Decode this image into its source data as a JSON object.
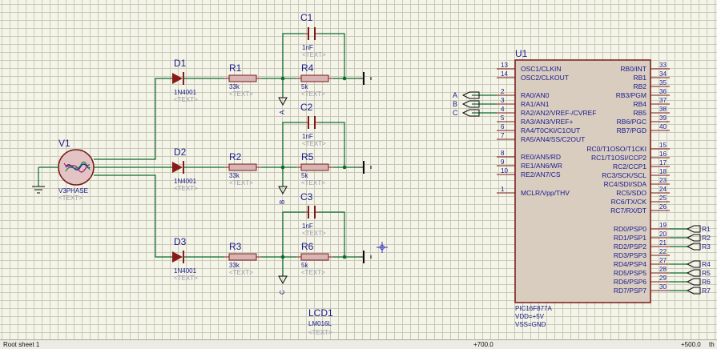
{
  "v1": {
    "ref": "V1",
    "value": "V3PHASE",
    "text": "<TEXT>"
  },
  "diodes": [
    {
      "ref": "D1",
      "value": "1N4001",
      "text": "<TEXT>"
    },
    {
      "ref": "D2",
      "value": "1N4001",
      "text": "<TEXT>"
    },
    {
      "ref": "D3",
      "value": "1N4001",
      "text": "<TEXT>"
    }
  ],
  "resistors_in": [
    {
      "ref": "R1",
      "value": "33k",
      "text": "<TEXT>"
    },
    {
      "ref": "R2",
      "value": "33k",
      "text": "<TEXT>"
    },
    {
      "ref": "R3",
      "value": "33k",
      "text": "<TEXT>"
    }
  ],
  "resistors_fb": [
    {
      "ref": "R4",
      "value": "5k",
      "text": "<TEXT>"
    },
    {
      "ref": "R5",
      "value": "5k",
      "text": "<TEXT>"
    },
    {
      "ref": "R6",
      "value": "5k",
      "text": "<TEXT>"
    }
  ],
  "capacitors": [
    {
      "ref": "C1",
      "value": "1nF",
      "text": "<TEXT>"
    },
    {
      "ref": "C2",
      "value": "1nF",
      "text": "<TEXT>"
    },
    {
      "ref": "C3",
      "value": "1nF",
      "text": "<TEXT>"
    }
  ],
  "node_labels": [
    "A",
    "B",
    "C"
  ],
  "mcu": {
    "ref": "U1",
    "part": "PIC16F877A",
    "vdd": "VDD=+5V",
    "vss": "VSS=GND",
    "left_pins": [
      {
        "num": "13",
        "name": "OSC1/CLKIN"
      },
      {
        "num": "14",
        "name": "OSC2/CLKOUT"
      },
      {
        "num": "2",
        "name": "RA0/AN0"
      },
      {
        "num": "3",
        "name": "RA1/AN1"
      },
      {
        "num": "4",
        "name": "RA2/AN2/VREF-/CVREF"
      },
      {
        "num": "5",
        "name": "RA3/AN3/VREF+"
      },
      {
        "num": "6",
        "name": "RA4/T0CKI/C1OUT"
      },
      {
        "num": "7",
        "name": "RA5/AN4/SS/C2OUT"
      },
      {
        "num": "8",
        "name": "RE0/AN5/RD"
      },
      {
        "num": "9",
        "name": "RE1/AN6/WR"
      },
      {
        "num": "10",
        "name": "RE2/AN7/CS"
      },
      {
        "num": "1",
        "name": "MCLR/Vpp/THV"
      }
    ],
    "right_pins": [
      {
        "num": "33",
        "name": "RB0/INT"
      },
      {
        "num": "34",
        "name": "RB1"
      },
      {
        "num": "35",
        "name": "RB2"
      },
      {
        "num": "36",
        "name": "RB3/PGM"
      },
      {
        "num": "37",
        "name": "RB4"
      },
      {
        "num": "38",
        "name": "RB5"
      },
      {
        "num": "39",
        "name": "RB6/PGC"
      },
      {
        "num": "40",
        "name": "RB7/PGD"
      },
      {
        "num": "15",
        "name": "RC0/T1OSO/T1CKI"
      },
      {
        "num": "16",
        "name": "RC1/T1OSI/CCP2"
      },
      {
        "num": "17",
        "name": "RC2/CCP1"
      },
      {
        "num": "18",
        "name": "RC3/SCK/SCL"
      },
      {
        "num": "23",
        "name": "RC4/SDI/SDA"
      },
      {
        "num": "24",
        "name": "RC5/SDO"
      },
      {
        "num": "25",
        "name": "RC6/TX/CK"
      },
      {
        "num": "26",
        "name": "RC7/RX/DT"
      },
      {
        "num": "19",
        "name": "RD0/PSP0"
      },
      {
        "num": "20",
        "name": "RD1/PSP1"
      },
      {
        "num": "21",
        "name": "RD2/PSP2"
      },
      {
        "num": "22",
        "name": "RD3/PSP3"
      },
      {
        "num": "27",
        "name": "RD4/PSP4"
      },
      {
        "num": "28",
        "name": "RD5/PSP5"
      },
      {
        "num": "29",
        "name": "RD6/PSP6"
      },
      {
        "num": "30",
        "name": "RD7/PSP7"
      }
    ]
  },
  "mcu_input_terminals": [
    "A",
    "B",
    "C"
  ],
  "port_d_terminals": [
    "R1",
    "R2",
    "R3",
    "R4",
    "R5",
    "R6",
    "R7"
  ],
  "lcd": {
    "ref": "LCD1",
    "value": "LM016L",
    "text": "<TEXT>"
  },
  "status": {
    "sheet": "Root sheet 1",
    "coord1": "+700.0",
    "coord2": "+500.0",
    "unit": "th"
  }
}
